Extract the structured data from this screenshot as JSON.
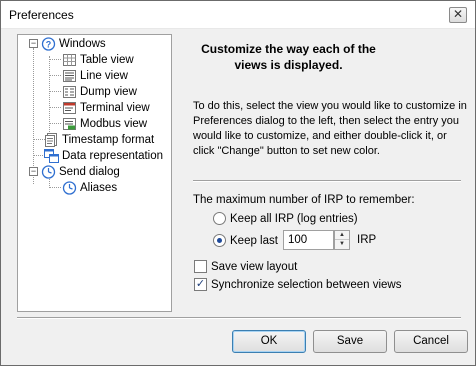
{
  "window": {
    "title": "Preferences",
    "close_label": "✕"
  },
  "tree": {
    "windows": {
      "label": "Windows",
      "icon": "help-circle-icon",
      "expander": "−"
    },
    "table_view": {
      "label": "Table view",
      "icon": "table-view-icon"
    },
    "line_view": {
      "label": "Line view",
      "icon": "line-view-icon"
    },
    "dump_view": {
      "label": "Dump view",
      "icon": "dump-view-icon"
    },
    "terminal_view": {
      "label": "Terminal view",
      "icon": "terminal-view-icon"
    },
    "modbus_view": {
      "label": "Modbus view",
      "icon": "modbus-view-icon"
    },
    "timestamp_format": {
      "label": "Timestamp format",
      "icon": "document-icon"
    },
    "data_representation": {
      "label": "Data representation",
      "icon": "window-cascade-icon"
    },
    "send_dialog": {
      "label": "Send dialog",
      "icon": "clock-icon",
      "expander": "−"
    },
    "aliases": {
      "label": "Aliases",
      "icon": "clock-icon"
    }
  },
  "main": {
    "heading": "Customize the way each of the views is displayed.",
    "description": "To do this, select the view you would like to customize in Preferences dialog to the left, then select the entry you would like to customize, and either double-click it, or click \"Change\" button to set new color.",
    "irp_label": "The maximum number of IRP to remember:",
    "keep_all_label": "Keep all IRP (log entries)",
    "keep_all_selected": false,
    "keep_last_label": "Keep last",
    "keep_last_selected": true,
    "keep_last_value": "100",
    "irp_unit": "IRP",
    "save_layout_label": "Save view layout",
    "save_layout_checked": false,
    "sync_selection_label": "Synchronize selection between views",
    "sync_selection_checked": true,
    "check_mark": "✓"
  },
  "buttons": {
    "ok": "OK",
    "save": "Save",
    "cancel": "Cancel"
  },
  "colors": {
    "accent": "#3c7fb1",
    "icon_blue": "#2f6fd0"
  }
}
